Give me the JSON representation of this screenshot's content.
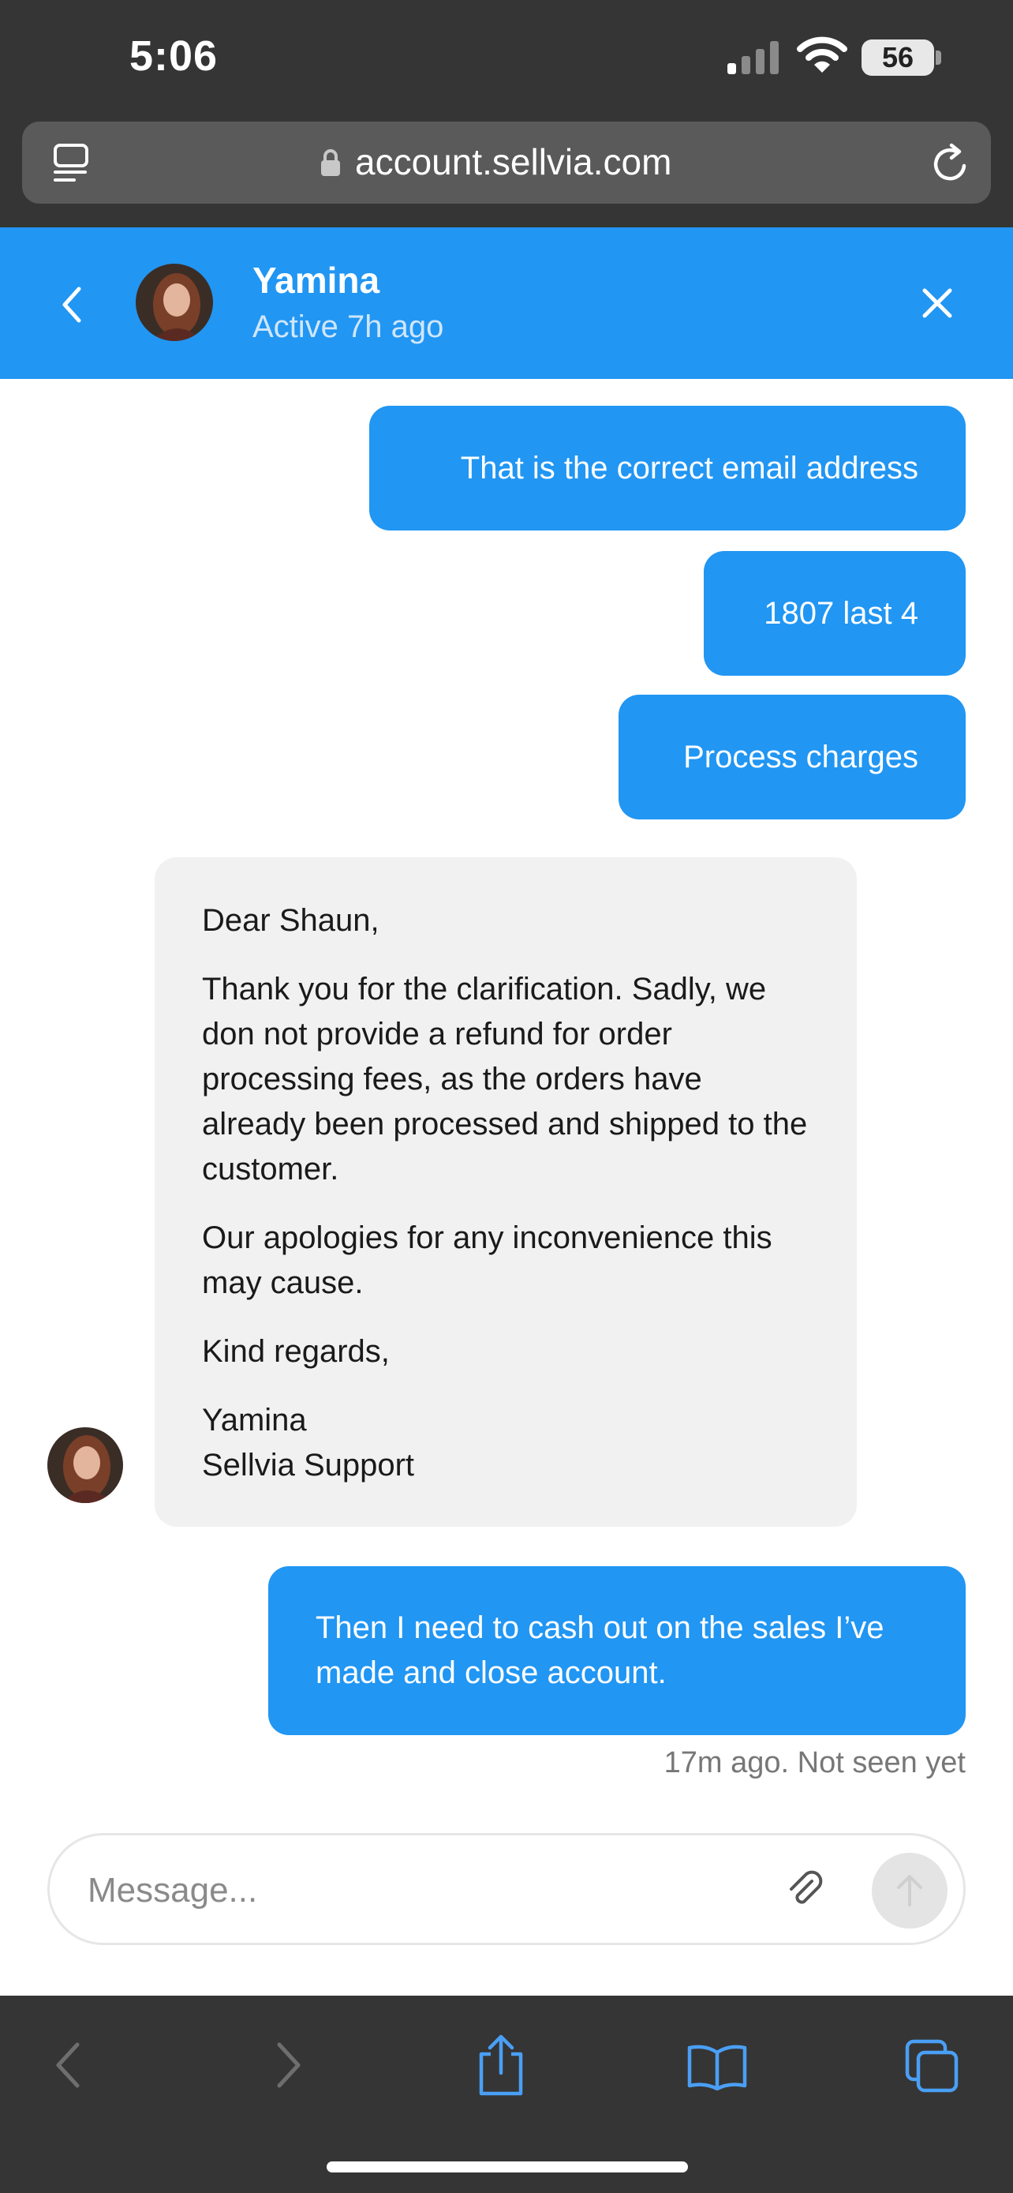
{
  "status_bar": {
    "time": "5:06",
    "battery": "56"
  },
  "browser": {
    "url": "account.sellvia.com"
  },
  "chat_header": {
    "name": "Yamina",
    "status": "Active 7h ago"
  },
  "messages": [
    {
      "from": "me",
      "text": "That is the correct email address"
    },
    {
      "from": "me",
      "text": "1807 last 4"
    },
    {
      "from": "me",
      "text": "Process charges"
    },
    {
      "from": "agent",
      "paragraphs": [
        "Dear Shaun,",
        "Thank you for the clarification. Sadly, we don not provide a refund for order processing fees, as the orders have already been processed and shipped to the customer.",
        "Our apologies for any inconvenience this may cause.",
        "Kind regards,",
        "Yamina\nSellvia Support"
      ]
    },
    {
      "from": "me",
      "text": "Then I need to cash out on the sales I’ve made and close account."
    }
  ],
  "message_meta": "17m ago. Not seen yet",
  "composer": {
    "placeholder": "Message..."
  },
  "colors": {
    "accent": "#2196f3",
    "chrome": "#353535",
    "incoming_bubble": "#f1f1f1"
  },
  "icons": [
    "tabs-icon",
    "lock-icon",
    "reload-icon",
    "back-chevron-icon",
    "close-icon",
    "attach-icon",
    "send-icon",
    "nav-back-icon",
    "nav-forward-icon",
    "share-icon",
    "bookmarks-icon",
    "tab-overview-icon"
  ]
}
